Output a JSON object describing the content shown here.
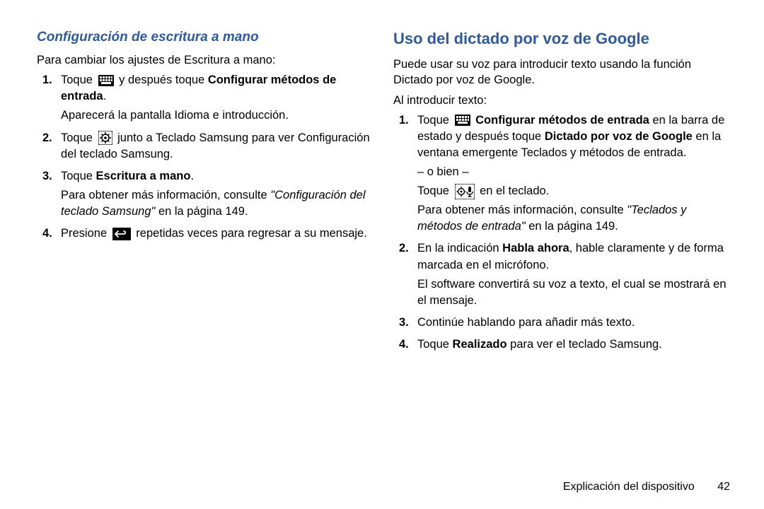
{
  "left": {
    "heading": "Configuración de escritura a mano",
    "intro": "Para cambiar los ajustes de Escritura a mano:",
    "steps": [
      {
        "num": "1.",
        "lines": [
          {
            "segments": [
              {
                "t": "Toque "
              },
              {
                "icon": "keyboard-icon"
              },
              {
                "t": " y después toque "
              },
              {
                "t": "Configurar métodos de entrada",
                "b": true
              },
              {
                "t": "."
              }
            ]
          },
          {
            "segments": [
              {
                "t": "Aparecerá la pantalla Idioma e introducción."
              }
            ]
          }
        ]
      },
      {
        "num": "2.",
        "lines": [
          {
            "segments": [
              {
                "t": "Toque "
              },
              {
                "icon": "gear-box-icon"
              },
              {
                "t": " junto a Teclado Samsung para ver Configuración del teclado Samsung."
              }
            ]
          }
        ]
      },
      {
        "num": "3.",
        "lines": [
          {
            "segments": [
              {
                "t": "Toque "
              },
              {
                "t": "Escritura a mano",
                "b": true
              },
              {
                "t": "."
              }
            ]
          },
          {
            "segments": [
              {
                "t": "Para obtener más información, consulte "
              },
              {
                "t": "\"Configuración del teclado Samsung\"",
                "it": true
              },
              {
                "t": "  en la página 149."
              }
            ]
          }
        ]
      },
      {
        "num": "4.",
        "lines": [
          {
            "segments": [
              {
                "t": "Presione "
              },
              {
                "icon": "back-icon"
              },
              {
                "t": " repetidas veces para regresar a su mensaje."
              }
            ]
          }
        ]
      }
    ]
  },
  "right": {
    "heading": "Uso del dictado por voz de Google",
    "intro1": "Puede usar su voz para introducir texto usando la función Dictado por voz de Google.",
    "intro2": "Al introducir texto:",
    "steps": [
      {
        "num": "1.",
        "lines": [
          {
            "segments": [
              {
                "t": "Toque "
              },
              {
                "icon": "keyboard-icon"
              },
              {
                "t": " "
              },
              {
                "t": "Configurar métodos de entrada",
                "b": true
              },
              {
                "t": " en la barra de estado y después toque "
              },
              {
                "t": "Dictado por voz de Google",
                "b": true
              },
              {
                "t": " en la ventana emergente Teclados y métodos de entrada."
              }
            ]
          },
          {
            "segments": [
              {
                "t": "– o bien –"
              }
            ]
          },
          {
            "segments": [
              {
                "t": "Toque "
              },
              {
                "icon": "gear-mic-icon"
              },
              {
                "t": " en el teclado."
              }
            ]
          },
          {
            "segments": [
              {
                "t": "Para obtener más información, consulte "
              },
              {
                "t": "\"Teclados y métodos de entrada\"",
                "it": true
              },
              {
                "t": "  en la página 149."
              }
            ]
          }
        ]
      },
      {
        "num": "2.",
        "lines": [
          {
            "segments": [
              {
                "t": "En la indicación "
              },
              {
                "t": "Habla ahora",
                "b": true
              },
              {
                "t": ", hable claramente y de forma marcada en el micrófono."
              }
            ]
          },
          {
            "segments": [
              {
                "t": "El software convertirá su voz a texto, el cual se mostrará en el mensaje."
              }
            ]
          }
        ]
      },
      {
        "num": "3.",
        "lines": [
          {
            "segments": [
              {
                "t": "Continúe hablando para añadir más texto."
              }
            ]
          }
        ]
      },
      {
        "num": "4.",
        "lines": [
          {
            "segments": [
              {
                "t": "Toque "
              },
              {
                "t": "Realizado",
                "b": true
              },
              {
                "t": " para ver el teclado Samsung."
              }
            ]
          }
        ]
      }
    ]
  },
  "footer": {
    "section": "Explicación del dispositivo",
    "page": "42"
  }
}
